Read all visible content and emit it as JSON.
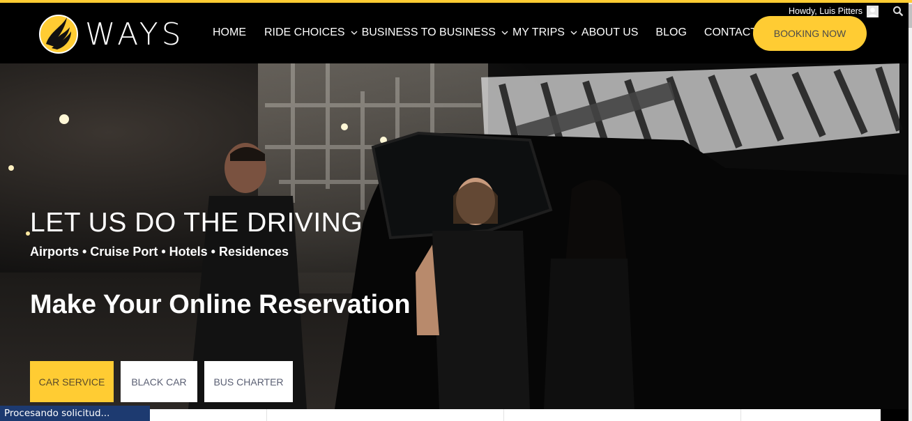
{
  "brand": {
    "name": "WAYS",
    "accent": "#ffcc33"
  },
  "nav": {
    "items": [
      {
        "label": "HOME",
        "dropdown": false
      },
      {
        "label": "RIDE CHOICES",
        "dropdown": true
      },
      {
        "label": "BUSINESS TO BUSINESS",
        "dropdown": true
      },
      {
        "label": "MY TRIPS",
        "dropdown": true
      },
      {
        "label": "ABOUT US",
        "dropdown": false
      },
      {
        "label": "BLOG",
        "dropdown": false
      },
      {
        "label": "CONTACT",
        "dropdown": false
      }
    ],
    "booking_label": "BOOKING NOW"
  },
  "user": {
    "greeting": "Howdy, Luis Pitters"
  },
  "hero": {
    "title": "LET US DO THE DRIVING",
    "subtitle": "Airports • Cruise Port • Hotels • Residences",
    "heading": "Make Your Online Reservation",
    "tabs": [
      {
        "label": "CAR SERVICE",
        "active": true
      },
      {
        "label": "BLACK CAR",
        "active": false
      },
      {
        "label": "BUS CHARTER",
        "active": false
      }
    ]
  },
  "status_bar": {
    "text": "Procesando solicitud..."
  }
}
